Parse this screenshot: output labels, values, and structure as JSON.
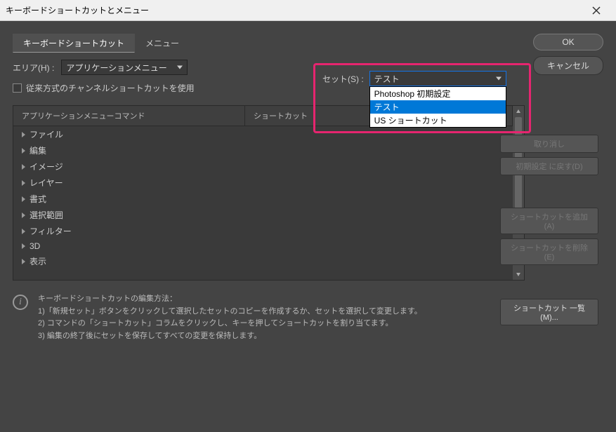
{
  "titlebar": {
    "title": "キーボードショートカットとメニュー"
  },
  "tabs": {
    "shortcuts": "キーボードショートカット",
    "menus": "メニュー"
  },
  "area": {
    "label": "エリア(H) :",
    "value": "アプリケーションメニュー"
  },
  "set": {
    "label": "セット(S) :",
    "value": "テスト",
    "options": [
      "Photoshop 初期設定",
      "テスト",
      "US ショートカット"
    ]
  },
  "legacy_checkbox": "従来方式のチャンネルショートカットを使用",
  "table": {
    "header1": "アプリケーションメニューコマンド",
    "header2": "ショートカット",
    "items": [
      "ファイル",
      "編集",
      "イメージ",
      "レイヤー",
      "書式",
      "選択範囲",
      "フィルター",
      "3D",
      "表示"
    ]
  },
  "side": {
    "undo": "取り消し",
    "reset": "初期設定 に戻す(D)",
    "add": "ショートカットを追加(A)",
    "del": "ショートカットを削除(E)",
    "summary": "ショートカット 一覧(M)..."
  },
  "right": {
    "ok": "OK",
    "cancel": "キャンセル"
  },
  "info": {
    "title": "キーボードショートカットの編集方法：",
    "l1": "1)「新規セット」ボタンをクリックして選択したセットのコピーを作成するか、セットを選択して変更します。",
    "l2": "2) コマンドの「ショートカット」コラムをクリックし、キーを押してショートカットを割り当てます。",
    "l3": "3) 編集の終了後にセットを保存してすべての変更を保持します。"
  }
}
